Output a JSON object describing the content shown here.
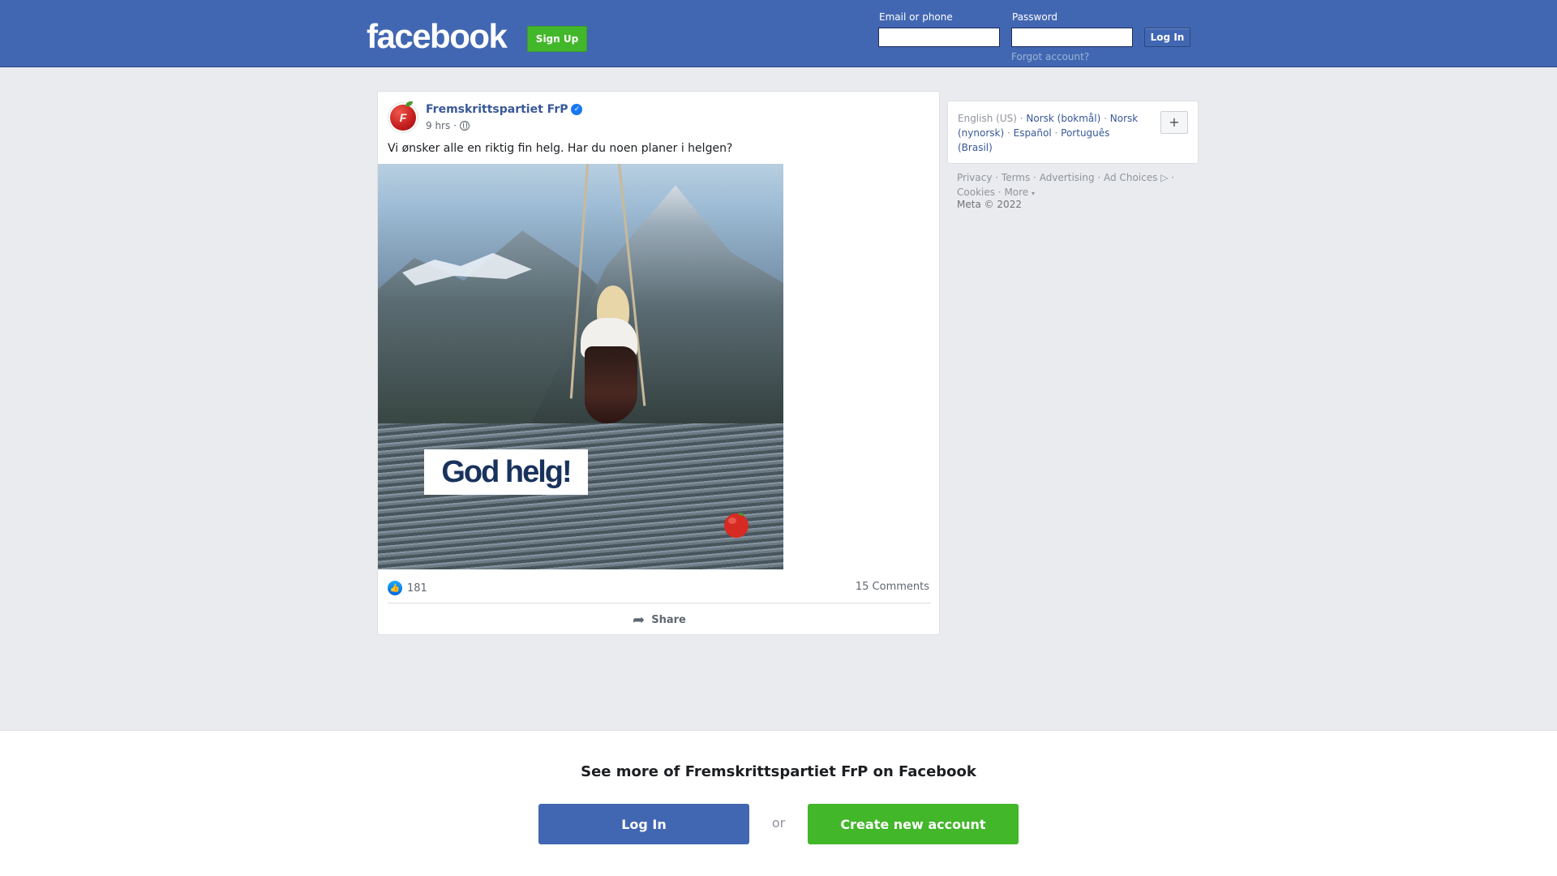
{
  "header": {
    "logo": "facebook",
    "signup_label": "Sign Up",
    "email_label": "Email or phone",
    "email_value": "",
    "password_label": "Password",
    "password_value": "",
    "login_label": "Log In",
    "forgot_label": "Forgot account?"
  },
  "post": {
    "page_name": "Fremskrittspartiet FrP",
    "verified": true,
    "time": "9 hrs",
    "separator": "·",
    "text": "Vi ønsker alle en riktig fin helg. Har du noen planer i helgen?",
    "image_caption": "God helg!",
    "logo_text": "F",
    "like_count": "181",
    "comments": "15 Comments",
    "share_label": "Share"
  },
  "languages": {
    "current": "English (US)",
    "items": [
      "Norsk (bokmål)",
      "Norsk (nynorsk)",
      "Español",
      "Português (Brasil)"
    ],
    "plus_label": "+"
  },
  "footer": {
    "links": [
      "Privacy",
      "Terms",
      "Advertising",
      "Ad Choices",
      "Cookies",
      "More"
    ],
    "copyright": "Meta © 2022"
  },
  "banner": {
    "title": "See more of Fremskrittspartiet FrP on Facebook",
    "login_label": "Log In",
    "or_label": "or",
    "create_label": "Create new account"
  },
  "colors": {
    "brand_blue": "#4267b2",
    "green": "#42b72a",
    "link": "#385898"
  }
}
